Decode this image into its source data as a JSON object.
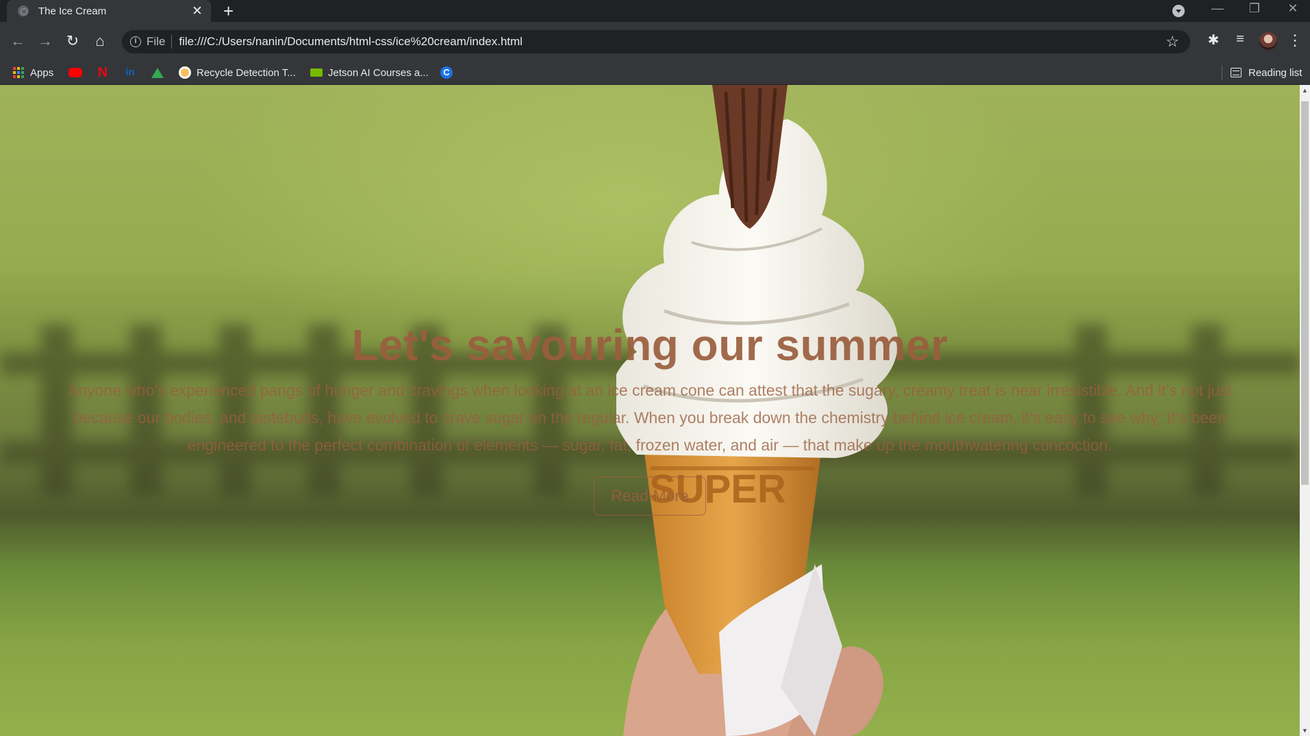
{
  "browser": {
    "tab_title": "The Ice Cream",
    "url_scheme_label": "File",
    "url": "file:///C:/Users/nanin/Documents/html-css/ice%20cream/index.html",
    "bookmarks": {
      "apps": "Apps",
      "recycle": "Recycle Detection T...",
      "jetson": "Jetson AI Courses a...",
      "reading_list": "Reading list"
    }
  },
  "hero": {
    "title": "Let's savouring our summer",
    "text": "Anyone who’s experienced pangs of hunger and cravings when looking at an ice cream cone can attest that the sugary, creamy treat is near irresistible. And it’s not just because our bodies, and tastebuds, have evolved to crave sugar on the regular. When you break down the chemistry behind ice cream, it’s easy to see why: It’s been engineered to the perfect combination of elements — sugar, fat, frozen water, and air — that make up the mouthwatering concoction.",
    "button": "Read More"
  },
  "cone_imprint": "SUPER",
  "colors": {
    "accent_text": "#9a5e3e",
    "chrome_dark": "#202124",
    "chrome_toolbar": "#35363a"
  }
}
